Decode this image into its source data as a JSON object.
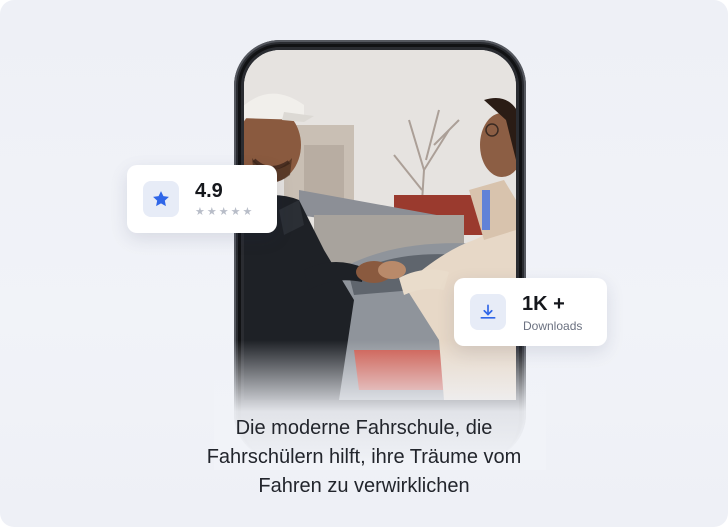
{
  "rating": {
    "value": "4.9",
    "stars": [
      "★",
      "★",
      "★",
      "★",
      "★"
    ],
    "icon": "star-icon",
    "accent": "#2f66e8"
  },
  "downloads": {
    "value": "1K +",
    "label": "Downloads",
    "icon": "download-icon",
    "accent": "#2f66e8"
  },
  "tagline": {
    "line1": "Die moderne Fahrschule, die",
    "line2": "Fahrschülern hilft, ihre Träume vom",
    "line3": "Fahren zu verwirklichen"
  },
  "phone": {
    "image": "driving-school-handshake-photo"
  }
}
